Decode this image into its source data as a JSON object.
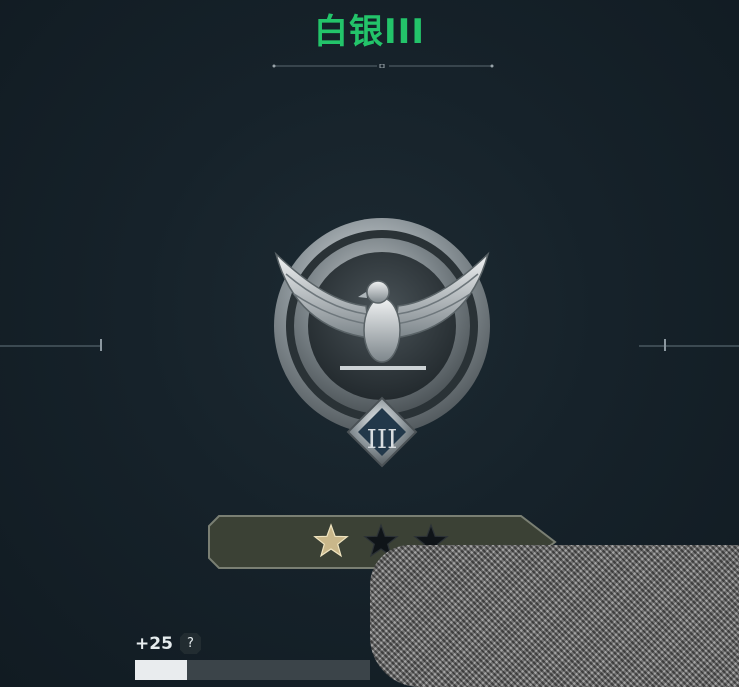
{
  "rank": {
    "title": "白银III",
    "tier_numeral": "III",
    "emblem_icon": "silver-eagle-emblem-icon"
  },
  "stars": {
    "earned": 1,
    "total": 3
  },
  "progress": {
    "points_gained": "+25",
    "help_label": "?",
    "fill_fraction": 0.22
  },
  "colors": {
    "title": "#23c46a",
    "star_earned": "#c9b78a",
    "star_empty": "#0f1418",
    "background": "#16222a"
  }
}
